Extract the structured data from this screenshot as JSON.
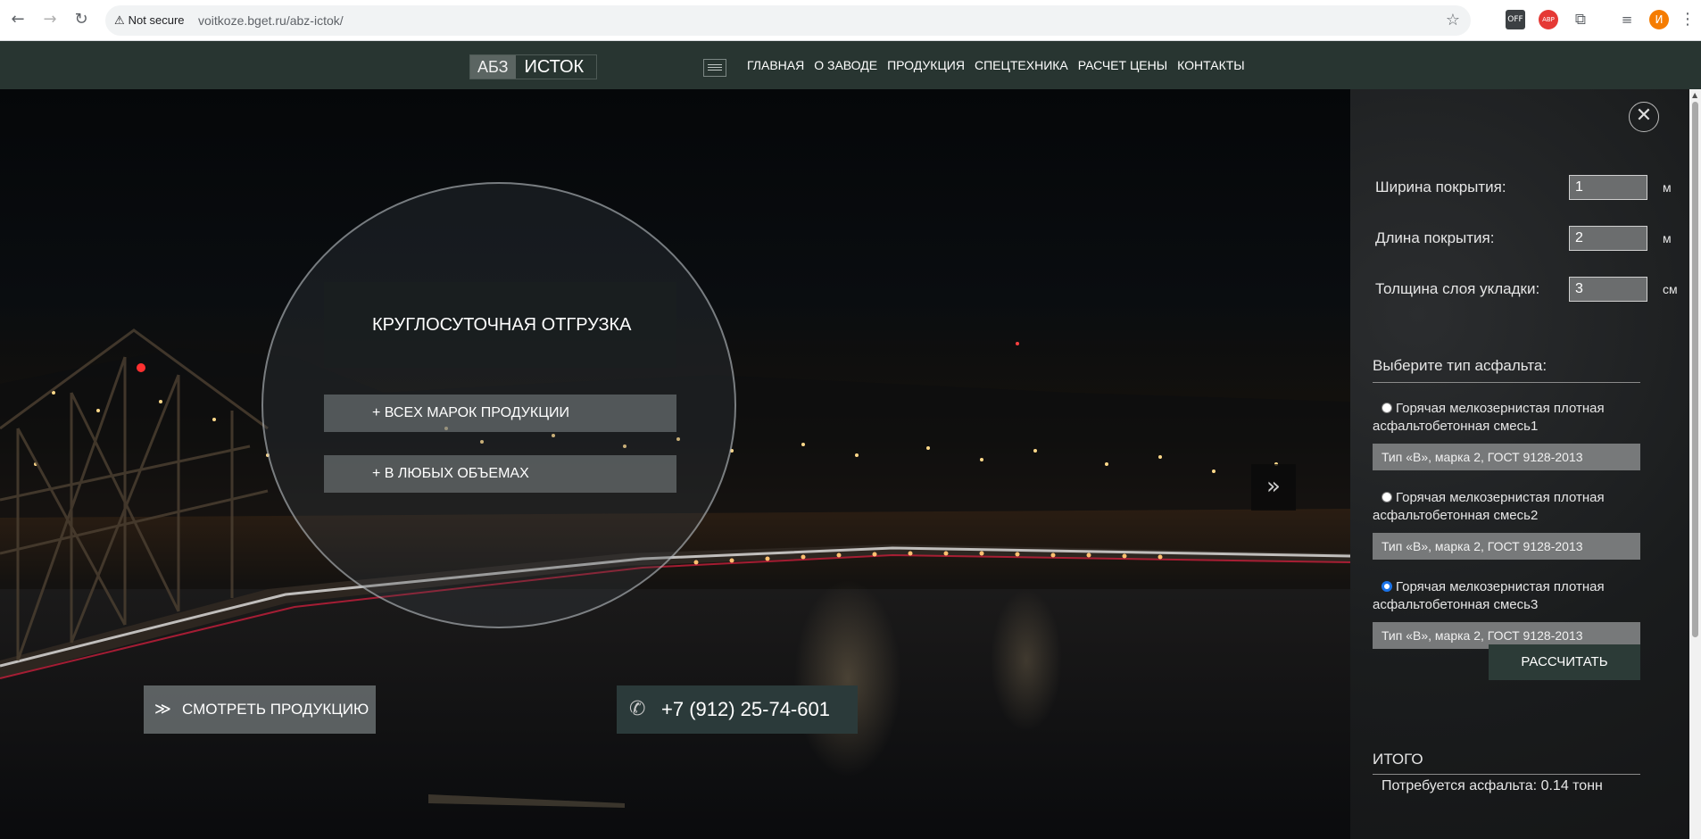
{
  "browser": {
    "back_icon": "←",
    "forward_icon": "→",
    "reload_icon": "↻",
    "security_label": "Not secure",
    "url": "voitkoze.bget.ru/abz-ictok/",
    "bookmark_icon": "☆",
    "ext_off_label": "OFF",
    "ext_abp_label": "ABP",
    "puzzle_icon": "⧉",
    "media_icon": "≡",
    "profile_initial": "И",
    "menu_icon": "⋮"
  },
  "header": {
    "logo_abz": "АБЗ",
    "logo_istok": "ИСТОК",
    "nav": [
      "ГЛАВНАЯ",
      "О ЗАВОДЕ",
      "ПРОДУКЦИЯ",
      "СПЕЦТЕХНИКА",
      "РАСЧЕТ ЦЕНЫ",
      "КОНТАКТЫ"
    ]
  },
  "hero": {
    "headline": "КРУГЛОСУТОЧНАЯ ОТГРУЗКА",
    "features": [
      "+ ВСЕХ МАРОК ПРОДУКЦИИ",
      "+ В ЛЮБЫХ ОБЪЕМАХ"
    ],
    "next_arrow": "»",
    "view_products": "СМОТРЕТЬ ПРОДУКЦИЮ",
    "chevron_icon": "≫",
    "phone": "+7 (912) 25-74-601",
    "phone_icon": "✆"
  },
  "calculator": {
    "close_icon": "✕",
    "width_label": "Ширина покрытия:",
    "width_value": "1",
    "width_unit": "м",
    "length_label": "Длина покрытия:",
    "length_value": "2",
    "length_unit": "м",
    "thickness_label": "Толщина слоя укладки:",
    "thickness_value": "3",
    "thickness_unit": "см",
    "type_heading": "Выберите тип асфальта:",
    "options": [
      {
        "label_line1": "Горячая мелкозернистая плотная",
        "label_line2": "асфальтобетонная смесь1",
        "spec": "Тип «В», марка 2, ГОСТ 9128-2013",
        "selected": false
      },
      {
        "label_line1": "Горячая мелкозернистая плотная",
        "label_line2": "асфальтобетонная смесь2",
        "spec": "Тип «В», марка 2, ГОСТ 9128-2013",
        "selected": false
      },
      {
        "label_line1": "Горячая мелкозернистая плотная",
        "label_line2": "асфальтобетонная смесь3",
        "spec": "Тип «В», марка 2, ГОСТ 9128-2013",
        "selected": true
      }
    ],
    "calc_button": "РАССЧИТАТЬ",
    "total_heading": "ИТОГО",
    "total_text": "Потребуется асфальта: 0.14 тонн"
  },
  "colors": {
    "header_bg": "#283531",
    "phone_bg": "#2b3a3a",
    "calc_button_bg": "#2c3b37",
    "radio_accent": "#1a73e8"
  }
}
